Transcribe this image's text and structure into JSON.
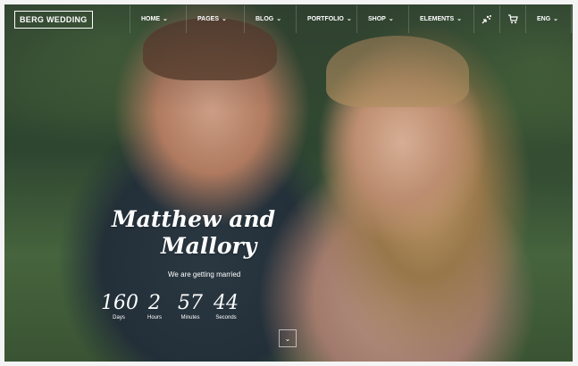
{
  "header": {
    "logo": "BERG WEDDING",
    "nav": [
      {
        "label": "HOME"
      },
      {
        "label": "PAGES"
      },
      {
        "label": "BLOG"
      },
      {
        "label": "PORTFOLIO"
      },
      {
        "label": "SHOP"
      },
      {
        "label": "ELEMENTS"
      }
    ],
    "language": "ENG",
    "icons": [
      "cursor-dots-icon",
      "cart-icon",
      "search-icon",
      "close-icon"
    ]
  },
  "hero": {
    "title_line1": "Matthew and",
    "title_line2": "Mallory",
    "subtitle": "We are getting married",
    "countdown": [
      {
        "value": "160",
        "label": "Days"
      },
      {
        "value": "2",
        "label": "Hours"
      },
      {
        "value": "57",
        "label": "Minutes"
      },
      {
        "value": "44",
        "label": "Seconds"
      }
    ]
  },
  "colors": {
    "text": "#ffffff",
    "overlay": "#1e2a33"
  }
}
